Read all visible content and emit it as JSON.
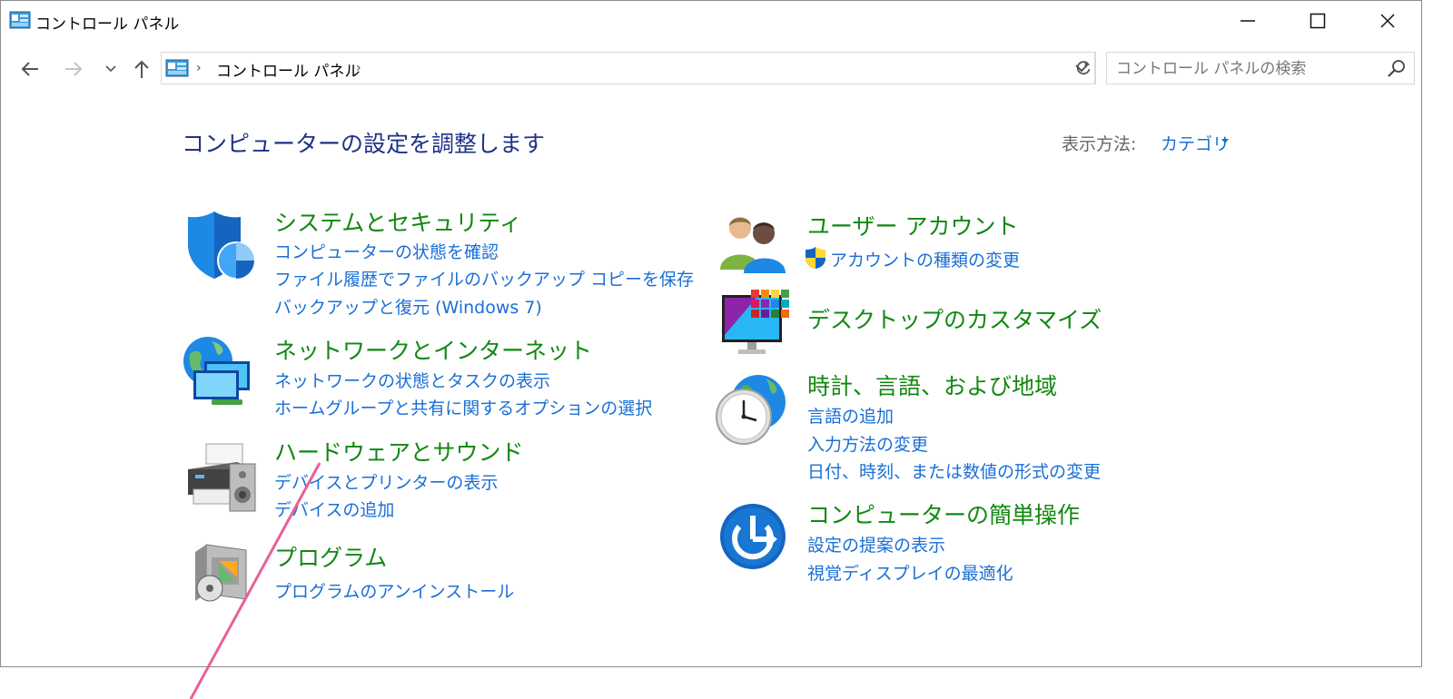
{
  "window": {
    "title": "コントロール パネル"
  },
  "navigation": {
    "back_icon": "arrow-left-icon",
    "forward_icon": "arrow-right-icon",
    "recent_icon": "chevron-down-icon",
    "up_icon": "arrow-up-icon",
    "address": "コントロール パネル",
    "search_placeholder": "コントロール パネルの検索"
  },
  "main": {
    "heading": "コンピューターの設定を調整します",
    "view_label": "表示方法:",
    "view_value": "カテゴリ"
  },
  "categories": {
    "system": {
      "title": "システムとセキュリティ",
      "links": [
        "コンピューターの状態を確認",
        "ファイル履歴でファイルのバックアップ コピーを保存",
        "バックアップと復元 (Windows 7)"
      ]
    },
    "network": {
      "title": "ネットワークとインターネット",
      "links": [
        "ネットワークの状態とタスクの表示",
        "ホームグループと共有に関するオプションの選択"
      ]
    },
    "hardware": {
      "title": "ハードウェアとサウンド",
      "links": [
        "デバイスとプリンターの表示",
        "デバイスの追加"
      ]
    },
    "programs": {
      "title": "プログラム",
      "links": [
        "プログラムのアンインストール"
      ]
    },
    "users": {
      "title": "ユーザー アカウント",
      "links": [
        "アカウントの種類の変更"
      ]
    },
    "appearance": {
      "title": "デスクトップのカスタマイズ",
      "links": []
    },
    "clock": {
      "title": "時計、言語、および地域",
      "links": [
        "言語の追加",
        "入力方法の変更",
        "日付、時刻、または数値の形式の変更"
      ]
    },
    "access": {
      "title": "コンピューターの簡単操作",
      "links": [
        "設定の提案の表示",
        "視覚ディスプレイの最適化"
      ]
    }
  },
  "colors": {
    "heading": "#1e3287",
    "category_title": "#118811",
    "link": "#1a6fd6",
    "annotation_line": "#e8609a"
  }
}
